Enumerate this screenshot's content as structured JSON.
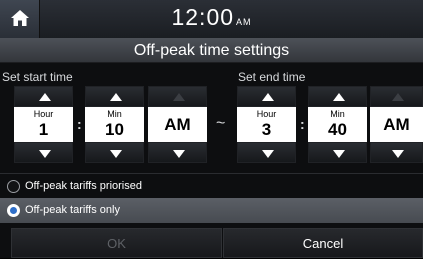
{
  "status": {
    "time": "12:00",
    "ampm": "AM"
  },
  "dialog": {
    "title": "Off-peak time settings",
    "start_label": "Set start time",
    "end_label": "Set end time",
    "separator": "~",
    "colon": ":",
    "start": {
      "hour_caption": "Hour",
      "hour": "1",
      "min_caption": "Min",
      "min": "10",
      "ampm": "AM"
    },
    "end": {
      "hour_caption": "Hour",
      "hour": "3",
      "min_caption": "Min",
      "min": "40",
      "ampm": "AM"
    },
    "options": [
      {
        "label": "Off-peak tariffs priorised",
        "selected": false
      },
      {
        "label": "Off-peak tariffs only",
        "selected": true
      }
    ],
    "ok_label": "OK",
    "cancel_label": "Cancel"
  }
}
